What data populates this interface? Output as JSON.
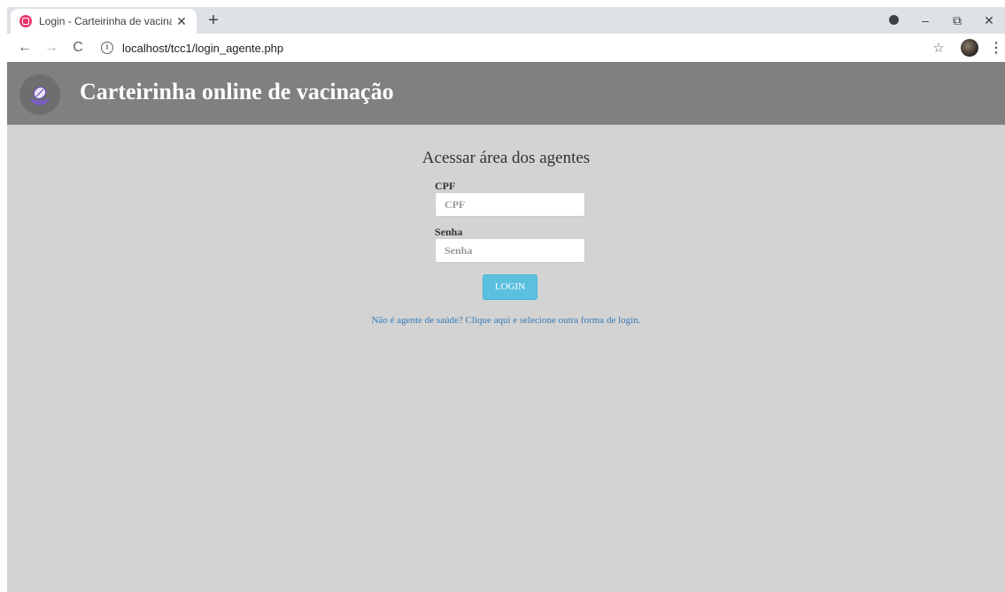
{
  "browser": {
    "tab_title": "Login - Carteirinha de vacinação",
    "tab_close": "✕",
    "new_tab": "+",
    "url": "localhost/tcc1/login_agente.php",
    "info_icon": "i",
    "icons": {
      "back": "←",
      "forward": "→",
      "reload": "C",
      "star": "☆",
      "menu": "⋮",
      "minimize": "–",
      "restore": "⧉",
      "close": "✕"
    }
  },
  "header": {
    "title": "Carteirinha online de vacinação"
  },
  "form": {
    "title": "Acessar área dos agentes",
    "cpf_label": "CPF",
    "cpf_placeholder": "CPF",
    "cpf_value": "",
    "senha_label": "Senha",
    "senha_placeholder": "Senha",
    "senha_value": "",
    "login_button": "LOGIN"
  },
  "alt_login_link": "Não é agente de saúde? Clique aqui e selecione outra forma de login.",
  "colors": {
    "page_background": "#d3d3d3",
    "header_background": "#808080",
    "button": "#5bc0de",
    "link": "#337ab7"
  }
}
